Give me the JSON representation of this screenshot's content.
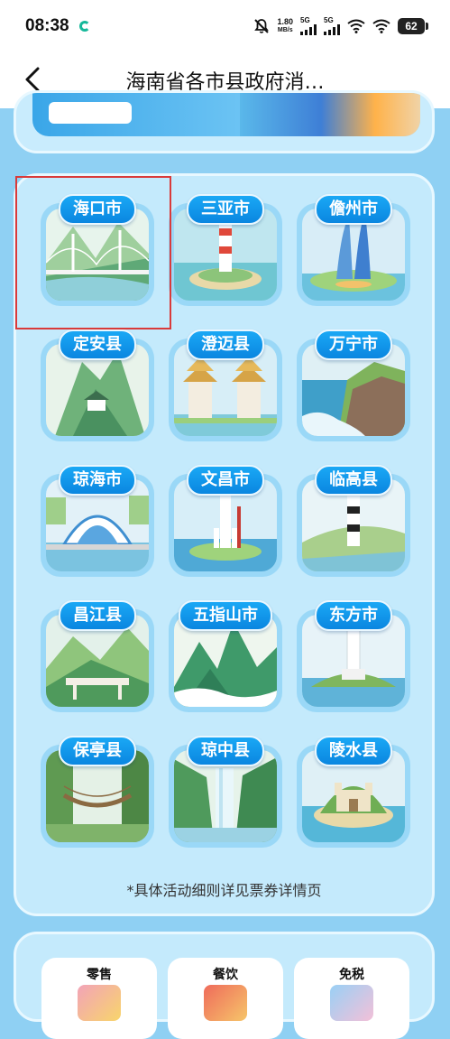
{
  "status_bar": {
    "time": "08:38",
    "net_speed_value": "1.80",
    "net_speed_unit": "MB/s",
    "sim1": "5G",
    "sim2": "5G",
    "battery": "62",
    "app_icon": "sync-icon"
  },
  "nav": {
    "back_icon": "chevron-left-icon",
    "title": "海南省各市县政府消…"
  },
  "cities": [
    {
      "name": "海口市",
      "scene": "bridge",
      "selected": true
    },
    {
      "name": "三亚市",
      "scene": "lighthouse-island",
      "selected": false
    },
    {
      "name": "儋州市",
      "scene": "twin-towers",
      "selected": false
    },
    {
      "name": "定安县",
      "scene": "mountain-pavilion",
      "selected": false
    },
    {
      "name": "澄迈县",
      "scene": "twin-pagodas",
      "selected": false
    },
    {
      "name": "万宁市",
      "scene": "cliffs",
      "selected": false
    },
    {
      "name": "琼海市",
      "scene": "forum-building",
      "selected": false
    },
    {
      "name": "文昌市",
      "scene": "rocket",
      "selected": false
    },
    {
      "name": "临高县",
      "scene": "striped-lighthouse",
      "selected": false
    },
    {
      "name": "昌江县",
      "scene": "valley-platform",
      "selected": false
    },
    {
      "name": "五指山市",
      "scene": "green-peaks",
      "selected": false
    },
    {
      "name": "东方市",
      "scene": "white-lighthouse",
      "selected": false
    },
    {
      "name": "保亭县",
      "scene": "rope-bridge",
      "selected": false
    },
    {
      "name": "琼中县",
      "scene": "waterfall",
      "selected": false
    },
    {
      "name": "陵水县",
      "scene": "castle-island",
      "selected": false
    }
  ],
  "footnote": "*具体活动细则详见票券详情页",
  "categories": [
    {
      "name": "零售"
    },
    {
      "name": "餐饮"
    },
    {
      "name": "免税"
    }
  ],
  "colors": {
    "page_bg": "#8fd0f3",
    "card_bg": "#c4eafc",
    "label_blue": "#0a86e0",
    "highlight_red": "#d93a3a"
  }
}
